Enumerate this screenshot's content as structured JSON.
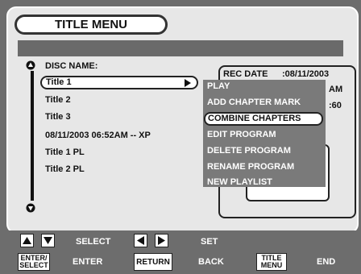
{
  "menu": {
    "title": "TITLE MENU"
  },
  "disc": {
    "label": "DISC NAME:",
    "titles": [
      "Title 1",
      "Title 2",
      "Title 3",
      "08/11/2003 06:52AM -- XP",
      "Title 1 PL",
      "Title 2 PL"
    ],
    "selected_index": 0
  },
  "info": {
    "rec_date_label": "REC DATE",
    "rec_date_value": ":08/11/2003",
    "line2_partial": "AM",
    "line3_partial": ":60"
  },
  "popup": {
    "items": [
      "PLAY",
      "ADD CHAPTER MARK",
      "COMBINE CHAPTERS",
      "EDIT PROGRAM",
      "DELETE PROGRAM",
      "RENAME PROGRAM",
      "NEW PLAYLIST"
    ],
    "active_index": 2
  },
  "legend": {
    "select_label": "SELECT",
    "set_label": "SET",
    "enter_key": "ENTER/\nSELECT",
    "enter_label": "ENTER",
    "return_key": "RETURN",
    "back_label": "BACK",
    "title_menu_key": "TITLE\nMENU",
    "end_label": "END"
  }
}
